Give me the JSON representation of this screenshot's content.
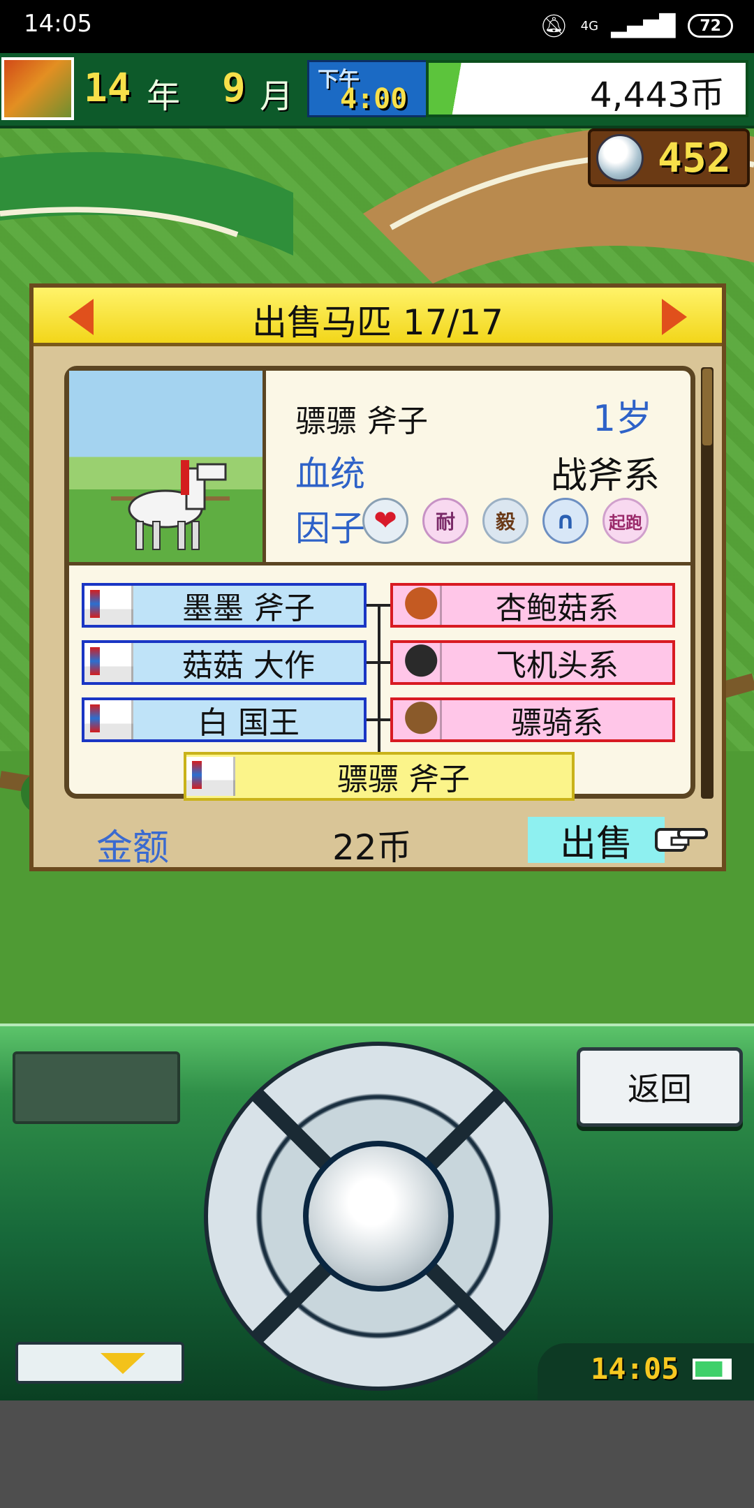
{
  "status_bar": {
    "time": "14:05",
    "network": "4G",
    "battery": "72"
  },
  "hud": {
    "year_value": "14",
    "year_unit": "年",
    "month_value": "9",
    "month_unit": "月",
    "period": "下午",
    "clock": "4:00",
    "money": "4,443币",
    "medals": "452"
  },
  "dialog": {
    "title": "出售马匹 17/17",
    "horse": {
      "name": "骠骠 斧子",
      "age": "1岁",
      "lineage_label": "血统",
      "lineage_value": "战斧系",
      "factor_label": "因子",
      "factors": {
        "heart": "❤",
        "stamina": "耐",
        "tough": "毅",
        "shoe": "∩",
        "start": "起跑"
      }
    },
    "pedigree": {
      "sires": [
        "墨墨 斧子",
        "菇菇 大作",
        "白 国王"
      ],
      "dams": [
        "杏鲍菇系",
        "飞机头系",
        "骠骑系"
      ],
      "self": "骠骠 斧子"
    },
    "price_label": "金额",
    "price_value": "22币",
    "sell_label": "出售"
  },
  "controller": {
    "back_label": "返回",
    "clock": "14:05"
  }
}
